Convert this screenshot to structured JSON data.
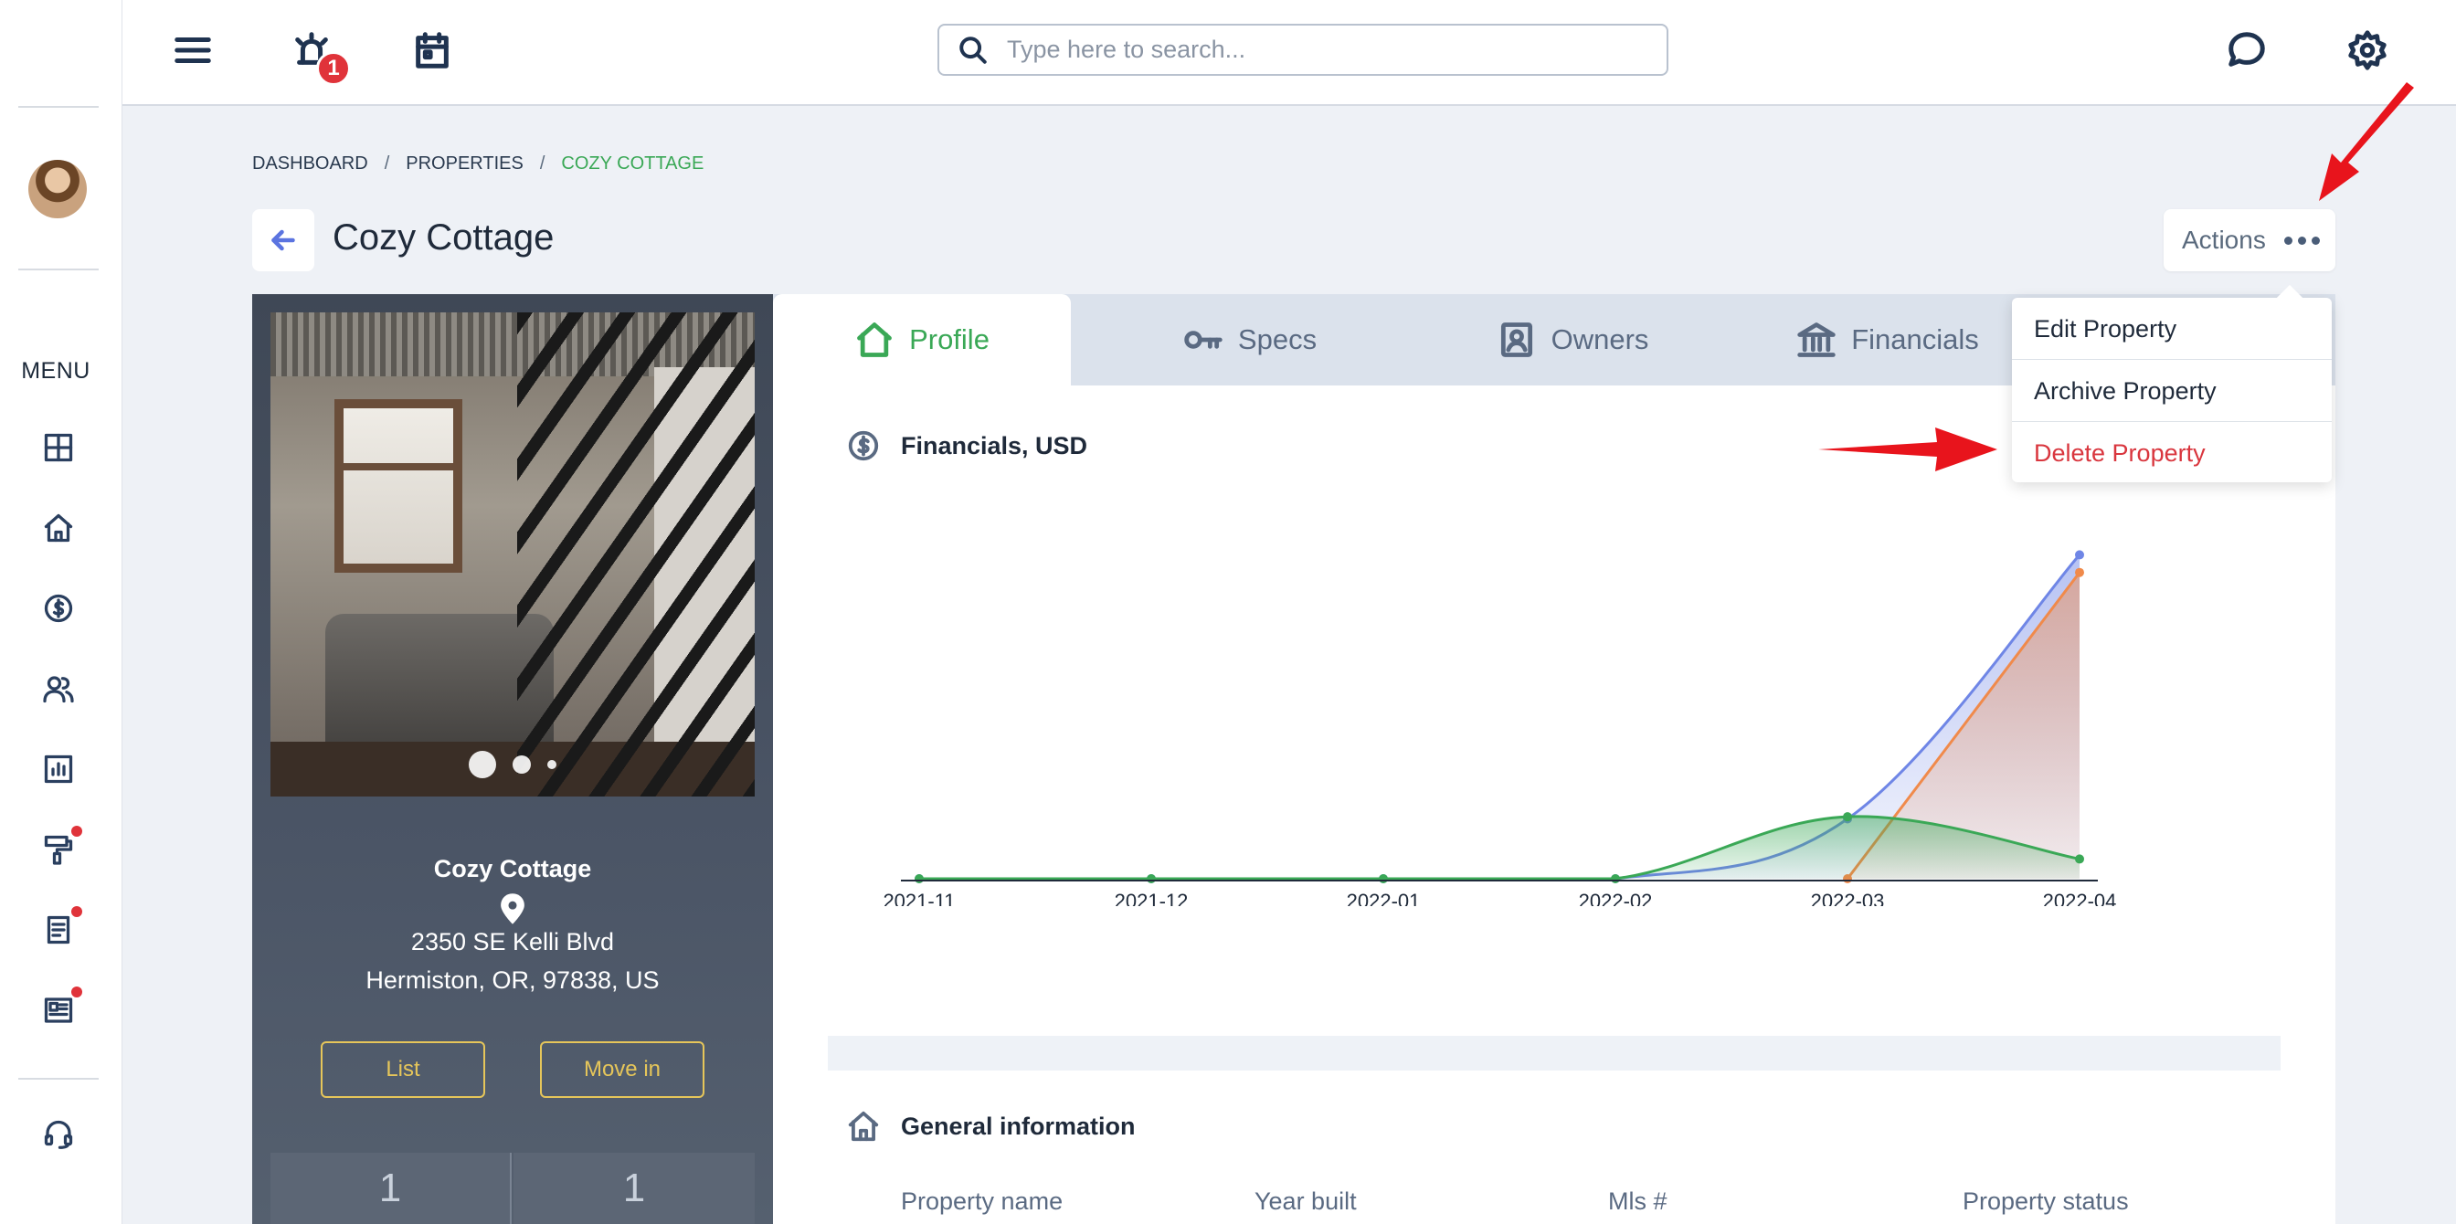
{
  "header": {
    "notification_count": "1",
    "search_placeholder": "Type here to search..."
  },
  "sidebar": {
    "menu_label": "MENU",
    "items": [
      {
        "name": "dashboard"
      },
      {
        "name": "properties"
      },
      {
        "name": "financials"
      },
      {
        "name": "people"
      },
      {
        "name": "reports"
      },
      {
        "name": "maintenance",
        "dot": true
      },
      {
        "name": "documents",
        "dot": true
      },
      {
        "name": "news",
        "dot": true
      }
    ]
  },
  "breadcrumb": {
    "items": [
      "DASHBOARD",
      "PROPERTIES",
      "COZY COTTAGE"
    ],
    "separator": "/"
  },
  "page": {
    "title": "Cozy Cottage",
    "actions_label": "Actions"
  },
  "actions_menu": {
    "items": [
      "Edit Property",
      "Archive Property",
      "Delete Property"
    ]
  },
  "property_card": {
    "name": "Cozy Cottage",
    "address_line1": "2350 SE Kelli Blvd",
    "address_line2": "Hermiston, OR, 97838, US",
    "list_button": "List",
    "move_in_button": "Move in",
    "stats": [
      "1",
      "1"
    ]
  },
  "tabs": [
    {
      "label": "Profile",
      "icon": "home-icon",
      "active": true
    },
    {
      "label": "Specs",
      "icon": "key-icon"
    },
    {
      "label": "Owners",
      "icon": "owner-icon"
    },
    {
      "label": "Financials",
      "icon": "bank-icon"
    }
  ],
  "financials_section": {
    "title": "Financials, USD"
  },
  "chart_data": {
    "type": "area",
    "categories": [
      "2021-11",
      "2021-12",
      "2022-01",
      "2022-02",
      "2022-03",
      "2022-04"
    ],
    "series": [
      {
        "color": "#6f86e6",
        "values": [
          0,
          0,
          0,
          0,
          85,
          460
        ]
      },
      {
        "color": "#f08a4b",
        "values": [
          null,
          null,
          null,
          null,
          0,
          435
        ]
      },
      {
        "color": "#3aa856",
        "values": [
          0,
          0,
          0,
          0,
          88,
          28
        ]
      }
    ],
    "ylim": [
      0,
      480
    ],
    "grid": false,
    "legend": "none"
  },
  "general_section": {
    "title": "General information",
    "fields": [
      "Property name",
      "Year built",
      "Mls #",
      "Property status"
    ]
  },
  "colors": {
    "accent_green": "#3aa856",
    "danger_red": "#d9363e",
    "annotation_red": "#e8141c",
    "button_yellow": "#e6c65a"
  }
}
